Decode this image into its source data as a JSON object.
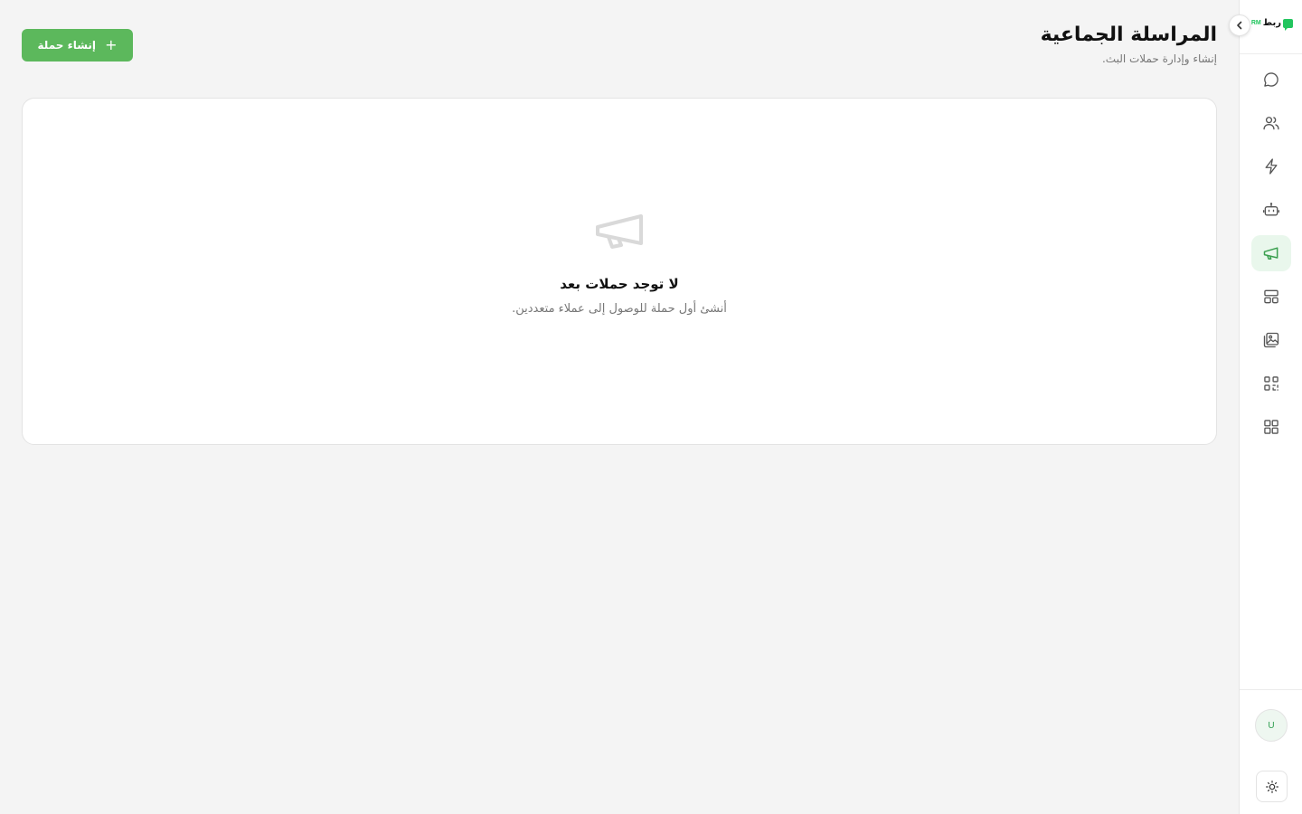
{
  "brand": {
    "name": "ربط",
    "accent": "RM"
  },
  "header": {
    "title": "المراسلة الجماعية",
    "subtitle": "إنشاء وإدارة حملات البث.",
    "create_button_label": "إنشاء حملة"
  },
  "empty_state": {
    "title": "لا توجد حملات بعد",
    "description": "أنشئ أول حملة للوصول إلى عملاء متعددين."
  },
  "sidebar": {
    "items": [
      {
        "icon": "chat-icon"
      },
      {
        "icon": "users-icon"
      },
      {
        "icon": "lightning-icon"
      },
      {
        "icon": "bot-icon"
      },
      {
        "icon": "megaphone-icon",
        "active": true
      },
      {
        "icon": "templates-icon"
      },
      {
        "icon": "media-gallery-icon"
      },
      {
        "icon": "qr-code-icon"
      },
      {
        "icon": "apps-grid-icon"
      }
    ],
    "avatar_initial": "U"
  },
  "colors": {
    "accent": "#5cb85c",
    "brand_green": "#22c55e",
    "active_bg": "#e9f7ec",
    "background": "#f4f4f4"
  }
}
